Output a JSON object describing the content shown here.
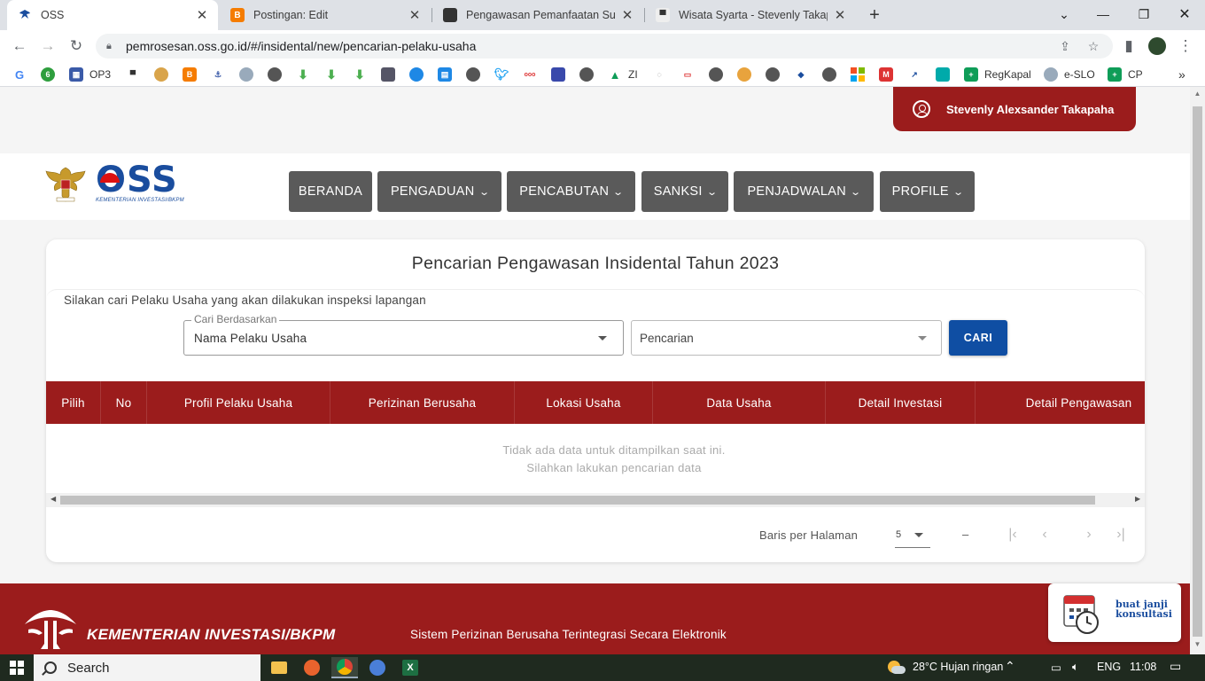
{
  "browser": {
    "tabs": [
      {
        "title": "OSS",
        "active": true
      },
      {
        "title": "Postingan: Edit",
        "active": false
      },
      {
        "title": "Pengawasan Pemanfaatan Sumbe",
        "active": false
      },
      {
        "title": "Wisata Syarta - Stevenly Takapah",
        "active": false
      }
    ],
    "new_tab": "+",
    "url": "pemrosesan.oss.go.id/#/insidental/new/pencarian-pelaku-usaha",
    "bookmarks": [
      {
        "label": "OP3"
      },
      {
        "label": "ZI"
      },
      {
        "label": "RegKapal"
      },
      {
        "label": "e-SLO"
      },
      {
        "label": "CP"
      }
    ]
  },
  "user": {
    "name": "Stevenly Alexsander Takapaha"
  },
  "logo": {
    "brand": "OSS",
    "subtitle": "KEMENTERIAN INVESTASI/BKPM"
  },
  "nav": [
    {
      "label": "BERANDA",
      "dropdown": false
    },
    {
      "label": "PENGADUAN",
      "dropdown": true
    },
    {
      "label": "PENCABUTAN",
      "dropdown": true
    },
    {
      "label": "SANKSI",
      "dropdown": true
    },
    {
      "label": "PENJADWALAN",
      "dropdown": true
    },
    {
      "label": "PROFILE",
      "dropdown": true
    }
  ],
  "card": {
    "title": "Pencarian Pengawasan Insidental Tahun 2023",
    "instruction": "Silakan cari Pelaku Usaha yang akan dilakukan inspeksi lapangan",
    "filter": {
      "legend": "Cari Berdasarkan",
      "value": "Nama Pelaku Usaha"
    },
    "search_placeholder": "Pencarian",
    "search_button": "CARI"
  },
  "table": {
    "columns": [
      "Pilih",
      "No",
      "Profil Pelaku Usaha",
      "Perizinan Berusaha",
      "Lokasi Usaha",
      "Data Usaha",
      "Detail Investasi",
      "Detail Pengawasan"
    ],
    "empty_line1": "Tidak ada data untuk ditampilkan saat ini.",
    "empty_line2": "Silahkan lakukan pencarian data"
  },
  "pagination": {
    "rows_label": "Baris per Halaman",
    "rows_value": "5",
    "range": "–"
  },
  "footer": {
    "ministry": "KEMENTERIAN INVESTASI/BKPM",
    "tagline": "Sistem Perizinan Berusaha Terintegrasi Secara Elektronik",
    "consult_line1": "buat janji",
    "consult_line2": "konsultasi"
  },
  "taskbar": {
    "search": "Search",
    "weather": "28°C  Hujan ringan",
    "lang": "ENG",
    "time": "11:08"
  },
  "colors": {
    "brand_red": "#9b1c1c",
    "brand_blue": "#0f4ea3",
    "nav_gray": "#5a5a5a"
  }
}
